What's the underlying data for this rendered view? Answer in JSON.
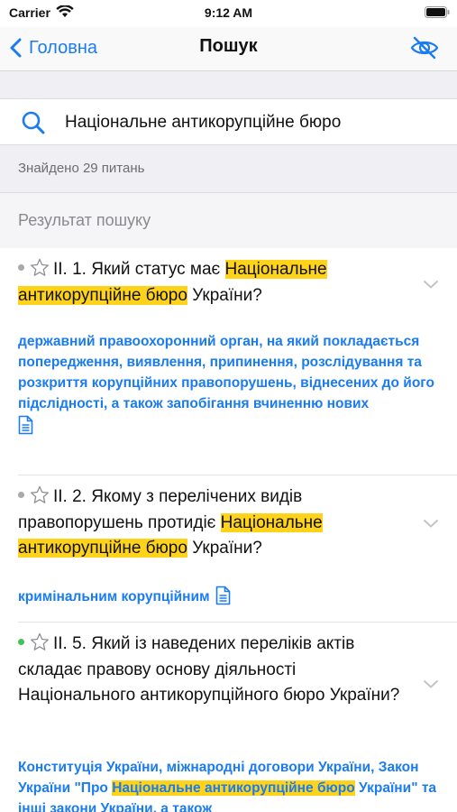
{
  "status_bar": {
    "carrier": "Carrier",
    "time": "9:12 AM"
  },
  "nav": {
    "back_label": "Головна",
    "title": "Пошук"
  },
  "search": {
    "value": "Національне антикорупційне бюро"
  },
  "found_text": "Знайдено 29 питань",
  "section_title": "Результат пошуку",
  "results": [
    {
      "status": "gray",
      "q_prefix": "ІІ. 1. Який статус має ",
      "q_highlight": "Національне антикорупційне бюро",
      "q_suffix": " України?",
      "answer": "державний правоохоронний орган, на який покладається попередження, виявлення, припинення, розслідування та розкриття корупційних правопорушень, віднесених до його підслідності, а також запобігання вчиненню нових"
    },
    {
      "status": "gray",
      "q_prefix": "ІІ. 2. Якому з перелічених видів правопорушень протидіє ",
      "q_highlight": "Національне антикорупційне бюро",
      "q_suffix": " України?",
      "answer": "кримінальним корупційним"
    },
    {
      "status": "green",
      "q_text": "ІІ. 5. Який із наведених переліків актів складає правову основу діяльності Національного антикорупційного бюро України?",
      "answer_prefix": "Конституція України, міжнародні договори України, Закон України \"Про ",
      "answer_highlight": "Національне антикорупційне бюро",
      "answer_suffix": " України\" та інші закони України, а також"
    }
  ],
  "colors": {
    "accent": "#1a7cf0",
    "highlight": "#ffd31a",
    "status_green": "#3cc45a",
    "status_gray": "#a9a9ad"
  }
}
